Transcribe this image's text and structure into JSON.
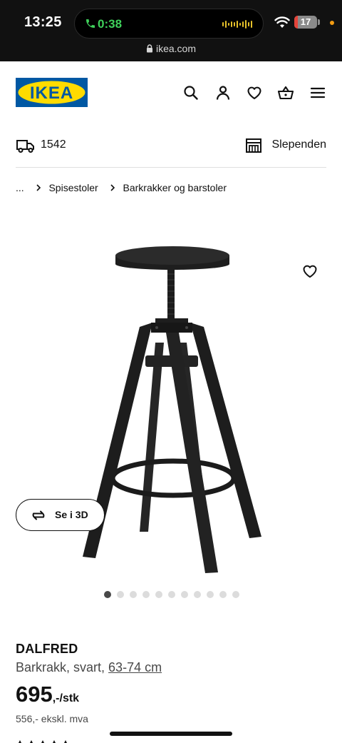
{
  "status_bar": {
    "time": "13:25",
    "call_timer": "0:38",
    "battery_level": "17",
    "battery_fraction": 0.17,
    "url": "ikea.com"
  },
  "header": {
    "logo_text": "IKEA",
    "brand_colors": {
      "blue": "#0058a3",
      "yellow": "#ffdb00"
    },
    "icons": [
      "search-icon",
      "account-icon",
      "heart-icon",
      "basket-icon",
      "menu-icon"
    ]
  },
  "delivery": {
    "postcode": "1542",
    "store": "Slependen"
  },
  "breadcrumb": {
    "ellipsis": "...",
    "items": [
      "Spisestoler",
      "Barkrakker og barstoler"
    ]
  },
  "gallery": {
    "view3d_label": "Se i 3D",
    "dot_count": 11,
    "active_index": 0
  },
  "product": {
    "name": "DALFRED",
    "description": "Barkrakk, svart,",
    "size": "63-74 cm",
    "price_integer": "695",
    "price_suffix": ",-/stk",
    "price_ex_vat": "556,- ekskl. mva"
  }
}
